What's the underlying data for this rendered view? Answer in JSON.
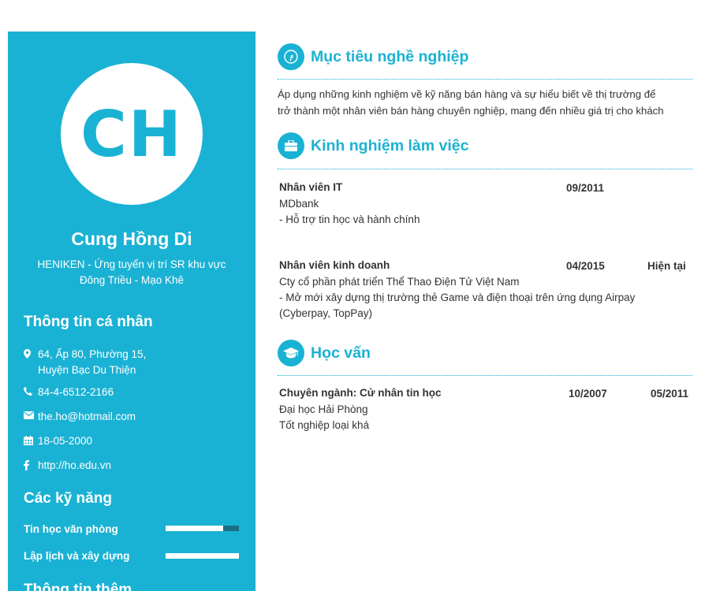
{
  "profile": {
    "initials": "CH",
    "name": "Cung Hồng Di",
    "subtitle_line1": "HENIKEN - Ứng tuyển vị trí SR khu vực",
    "subtitle_line2": "Đông Triều - Mạo Khê"
  },
  "personal": {
    "heading": "Thông tin cá nhân",
    "address_line1": "64, Ấp 80, Phường 15,",
    "address_line2": "Huyện Bạc Du Thiện",
    "phone": "84-4-6512-2166",
    "email": "the.ho@hotmail.com",
    "birthday": "18-05-2000",
    "website": "http://ho.edu.vn"
  },
  "skills": {
    "heading": "Các kỹ năng",
    "items": [
      {
        "label": "Tin học văn phòng",
        "level": 0.78
      },
      {
        "label": "Lập lịch và xây dựng",
        "level": 1.0
      }
    ]
  },
  "extra": {
    "heading": "Thông tin thêm"
  },
  "objective": {
    "title": "Mục tiêu nghề nghiệp",
    "line1": "Áp dụng những kinh nghiệm về kỹ năng bán hàng và sự hiểu biết về thị trường để",
    "line2": "trở thành một nhân viên bán hàng chuyên nghiệp, mang đến nhiều giá trị cho khách"
  },
  "experience": {
    "title": "Kinh nghiệm làm việc",
    "jobs": [
      {
        "position": "Nhân viên IT",
        "start": "09/2011",
        "end": "",
        "company": "MDbank",
        "desc1": "- Hỗ trợ tin học và hành chính",
        "desc2": ""
      },
      {
        "position": "Nhân viên kinh doanh",
        "start": "04/2015",
        "end": "Hiện tại",
        "company": "Cty cổ phần phát triển Thể Thao Điện Tử Việt Nam",
        "desc1": "- Mở mới xây dựng thị trường thẻ Game và điện thoại trên ứng dụng Airpay",
        "desc2": "(Cyberpay, TopPay)"
      }
    ]
  },
  "education": {
    "title": "Học vấn",
    "major": "Chuyên ngành: Cử nhân tin học",
    "start": "10/2007",
    "end": "05/2011",
    "school": "Đại học Hải Phòng",
    "grade": "Tốt nghiệp loại khá"
  },
  "colors": {
    "accent": "#1ab2d4",
    "bar_bg": "#1a6e84"
  }
}
